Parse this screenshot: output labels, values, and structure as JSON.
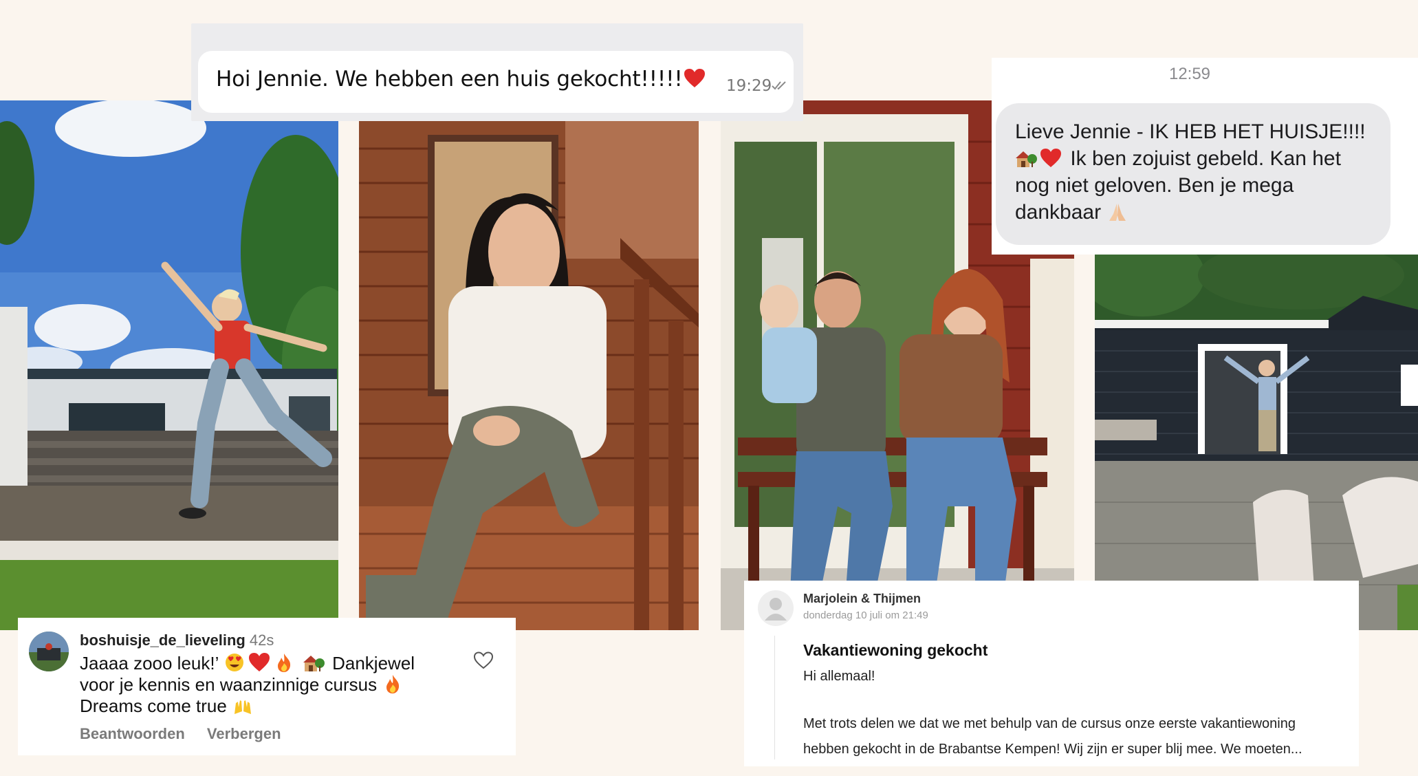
{
  "chat_top": {
    "message": "Hoi Jennie. We hebben een huis gekocht!!!!!",
    "emoji": "red-heart",
    "time": "19:29",
    "status_icon": "double-check-icon"
  },
  "chat_right": {
    "time": "12:59",
    "line1": "Lieve Jennie - IK HEB HET HUISJE!!!!",
    "line2": "Ik ben zojuist gebeld. Kan het",
    "line3": "nog niet geloven. Ben je mega",
    "line4": "dankbaar",
    "emojis": [
      "house-with-garden",
      "red-heart",
      "folded-hands"
    ]
  },
  "comment": {
    "username": "boshuisje_de_lieveling",
    "age": "42s",
    "line1_a": "Jaaaa zooo leuk!’",
    "line1_b": "Dankjewel",
    "line2": "voor je kennis en waanzinnige cursus",
    "line3": "Dreams come true",
    "reply_label": "Beantwoorden",
    "hide_label": "Verbergen",
    "emojis": [
      "heart-eyes",
      "red-heart",
      "fire",
      "house-with-garden",
      "fire",
      "raising-hands"
    ]
  },
  "post": {
    "author": "Marjolein & Thijmen",
    "date": "donderdag 10 juli om 21:49",
    "title": "Vakantiewoning gekocht",
    "greeting": "Hi allemaal!",
    "body_line1": "Met trots delen we dat we met behulp van de cursus onze eerste vakantiewoning",
    "body_line2": "hebben gekocht in de Brabantse Kempen! Wij zijn er super blij mee. We moeten..."
  },
  "photos": [
    {
      "name": "photo-jumping-woman",
      "subject": "woman jumping in garden in front of chalet"
    },
    {
      "name": "photo-woman-on-steps",
      "subject": "woman sitting on porch steps of wooden chalet"
    },
    {
      "name": "photo-family-on-bench",
      "subject": "couple with baby on bench in front of red chalet"
    },
    {
      "name": "photo-man-at-house",
      "subject": "man with open arms in front of black holiday house"
    }
  ],
  "colors": {
    "background": "#fbf5ee",
    "chat_bubble_grey": "#e9e9eb",
    "whatsapp_frame": "#ececee"
  }
}
